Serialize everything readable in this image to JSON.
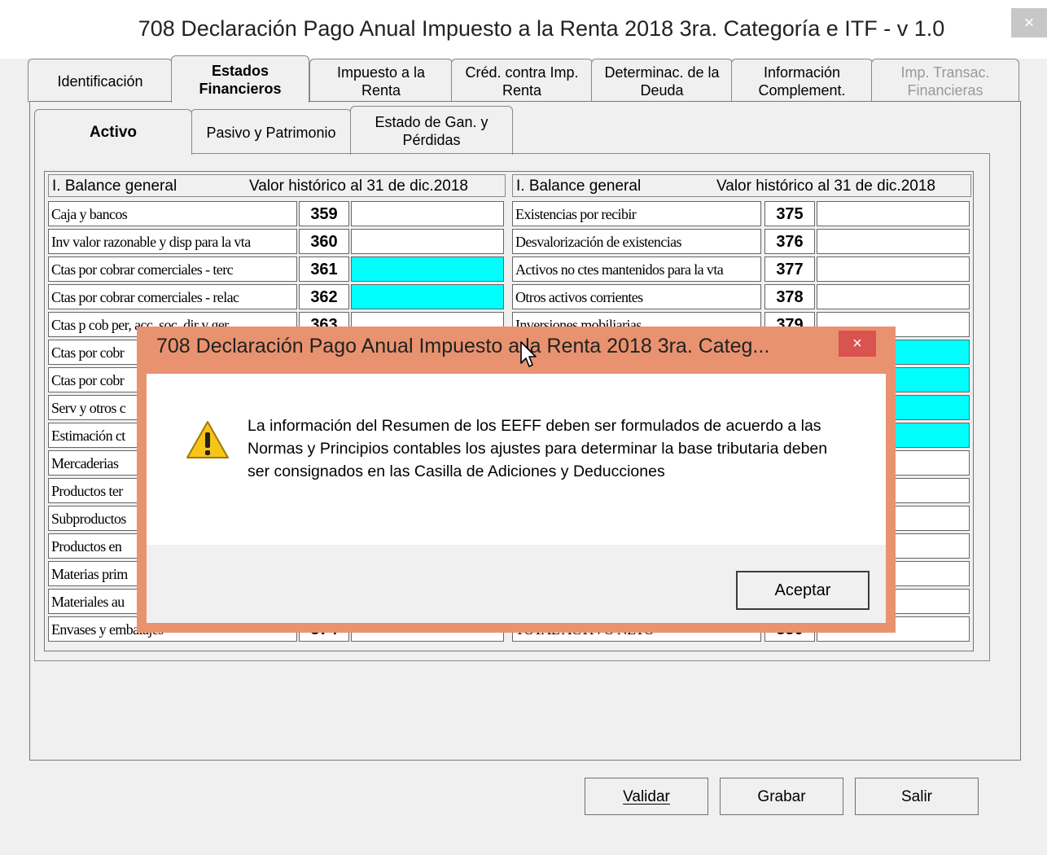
{
  "window": {
    "title": "708 Declaración Pago Anual Impuesto a la Renta 2018 3ra. Categoría e ITF - v 1.0",
    "close_glyph": "×"
  },
  "main_tabs": [
    {
      "label": "Identificación"
    },
    {
      "label": "Estados Financieros"
    },
    {
      "label": "Impuesto a la Renta"
    },
    {
      "label": "Créd. contra Imp. Renta"
    },
    {
      "label": "Determinac. de la Deuda"
    },
    {
      "label": "Información Complement."
    },
    {
      "label": "Imp. Transac. Financieras"
    }
  ],
  "sub_tabs": [
    {
      "label": "Activo"
    },
    {
      "label": "Pasivo y Patrimonio"
    },
    {
      "label": "Estado de Gan. y Pérdidas"
    }
  ],
  "grid": {
    "left_header": {
      "title": "I. Balance general",
      "value_header": "Valor histórico al 31 de dic.2018"
    },
    "right_header": {
      "title": "I. Balance general",
      "value_header": "Valor histórico al 31 de dic.2018"
    },
    "left_rows": [
      {
        "label": "Caja y bancos",
        "code": "359",
        "value": "",
        "highlight": false
      },
      {
        "label": "Inv valor razonable y disp para la vta",
        "code": "360",
        "value": "",
        "highlight": false
      },
      {
        "label": "Ctas por cobrar comerciales - terc",
        "code": "361",
        "value": "",
        "highlight": true
      },
      {
        "label": "Ctas por cobrar comerciales - relac",
        "code": "362",
        "value": "",
        "highlight": true
      },
      {
        "label": "Ctas p cob per, acc, soc, dir y ger",
        "code": "363",
        "value": "",
        "highlight": false
      },
      {
        "label": "Ctas por cobr",
        "code": "",
        "value": "",
        "highlight": false
      },
      {
        "label": "Ctas por cobr",
        "code": "",
        "value": "",
        "highlight": false
      },
      {
        "label": "Serv y otros c",
        "code": "",
        "value": "",
        "highlight": false
      },
      {
        "label": "Estimación ct",
        "code": "",
        "value": "",
        "highlight": false
      },
      {
        "label": "Mercaderias",
        "code": "",
        "value": "",
        "highlight": false
      },
      {
        "label": "Productos ter",
        "code": "",
        "value": "",
        "highlight": false
      },
      {
        "label": "Subproductos",
        "code": "",
        "value": "",
        "highlight": false
      },
      {
        "label": "Productos en",
        "code": "",
        "value": "",
        "highlight": false
      },
      {
        "label": "Materias prim",
        "code": "",
        "value": "",
        "highlight": false
      },
      {
        "label": "Materiales au",
        "code": "",
        "value": "",
        "highlight": false
      },
      {
        "label": "Envases y embalajes",
        "code": "374",
        "value": "",
        "highlight": false
      }
    ],
    "right_rows": [
      {
        "label": "Existencias por recibir",
        "code": "375",
        "value": "",
        "highlight": false
      },
      {
        "label": "Desvalorización de existencias",
        "code": "376",
        "value": "",
        "highlight": false
      },
      {
        "label": "Activos no ctes mantenidos para la vta",
        "code": "377",
        "value": "",
        "highlight": false
      },
      {
        "label": "Otros activos corrientes",
        "code": "378",
        "value": "",
        "highlight": false
      },
      {
        "label": "Inversiones mobiliarias",
        "code": "379",
        "value": "",
        "highlight": false
      },
      {
        "label": "",
        "code": "",
        "value": "",
        "highlight": true
      },
      {
        "label": "",
        "code": "",
        "value": "",
        "highlight": true
      },
      {
        "label": "",
        "code": "",
        "value": "",
        "highlight": true
      },
      {
        "label": "",
        "code": "",
        "value": "",
        "highlight": true
      },
      {
        "label": "",
        "code": "",
        "value": "",
        "highlight": false
      },
      {
        "label": "",
        "code": "",
        "value": "",
        "highlight": false
      },
      {
        "label": "",
        "code": "",
        "value": "",
        "highlight": false
      },
      {
        "label": "",
        "code": "",
        "value": "",
        "highlight": false
      },
      {
        "label": "",
        "code": "",
        "value": "",
        "highlight": false
      },
      {
        "label": "",
        "code": "",
        "value": "",
        "highlight": false
      },
      {
        "label": "TOTAL ACTIVO NETO",
        "code": "350",
        "value": "",
        "highlight": false
      }
    ]
  },
  "buttons": {
    "validar": "Validar",
    "grabar": "Grabar",
    "salir": "Salir"
  },
  "dialog": {
    "title": "708 Declaración Pago Anual Impuesto a la Renta 2018 3ra. Categ...",
    "close_glyph": "×",
    "message": "La información del Resumen de los EEFF deben ser formulados de acuerdo a las Normas y Principios contables los ajustes para determinar la base tributaria deben ser consignados en las Casilla de Adiciones y Deducciones",
    "ok_label": "Aceptar",
    "icon": "warning-icon"
  },
  "colors": {
    "highlight_cyan": "#00ffff",
    "dialog_frame": "#e9926f",
    "dialog_close": "#d9534f"
  }
}
